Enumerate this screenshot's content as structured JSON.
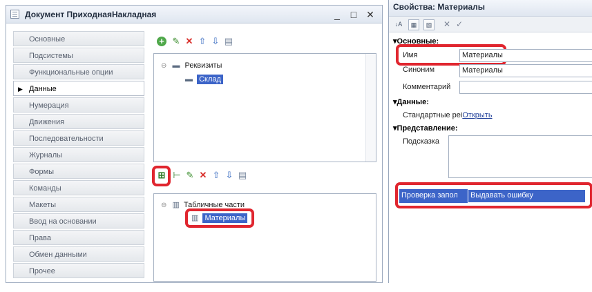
{
  "document_window": {
    "title": "Документ ПриходнаяНакладная",
    "controls": {
      "minimize": "_",
      "maximize": "□",
      "close": "✕"
    }
  },
  "nav": {
    "items": [
      {
        "label": "Основные"
      },
      {
        "label": "Подсистемы"
      },
      {
        "label": "Функциональные опции"
      },
      {
        "label": "Данные",
        "active": true
      },
      {
        "label": "Нумерация"
      },
      {
        "label": "Движения"
      },
      {
        "label": "Последовательности"
      },
      {
        "label": "Журналы"
      },
      {
        "label": "Формы"
      },
      {
        "label": "Команды"
      },
      {
        "label": "Макеты"
      },
      {
        "label": "Ввод на основании"
      },
      {
        "label": "Права"
      },
      {
        "label": "Обмен данными"
      },
      {
        "label": "Прочее"
      }
    ]
  },
  "requisites": {
    "root_label": "Реквизиты",
    "items": [
      "Склад"
    ]
  },
  "tabular_parts": {
    "root_label": "Табличные части",
    "items": [
      "Материалы"
    ]
  },
  "properties": {
    "title": "Свойства: Материалы",
    "sections": {
      "main": "Основные:",
      "data": "Данные:",
      "presentation": "Представление:"
    },
    "fields": {
      "name_label": "Имя",
      "name_value": "Материалы",
      "synonym_label": "Синоним",
      "synonym_value": "Материалы",
      "comment_label": "Комментарий",
      "comment_value": "",
      "std_label": "Стандартные реі",
      "std_link": "Открыть",
      "hint_label": "Подсказка",
      "fill_check_label": "Проверка запол",
      "fill_check_value": "Выдавать ошибку"
    }
  },
  "colors": {
    "highlight": "#e0262f",
    "selection": "#3c64c8"
  }
}
